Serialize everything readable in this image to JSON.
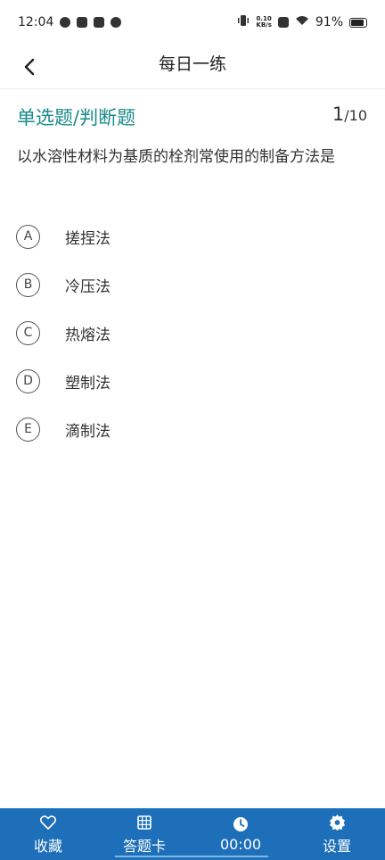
{
  "status_bar": {
    "time": "12:04",
    "net_speed_value": "0.10",
    "net_speed_unit": "KB/s",
    "battery": "91%"
  },
  "header": {
    "title": "每日一练",
    "back_icon": "chevron-left-icon"
  },
  "question": {
    "section_title": "单选题/判断题",
    "current": "1",
    "total": "/10",
    "text": "以水溶性材料为基质的栓剂常使用的制备方法是",
    "options": [
      {
        "letter": "A",
        "text": "搓捏法"
      },
      {
        "letter": "B",
        "text": "冷压法"
      },
      {
        "letter": "C",
        "text": "热熔法"
      },
      {
        "letter": "D",
        "text": "塑制法"
      },
      {
        "letter": "E",
        "text": "滴制法"
      }
    ]
  },
  "bottom_bar": {
    "tabs": [
      {
        "label": "收藏",
        "icon": "heart-icon"
      },
      {
        "label": "答题卡",
        "icon": "grid-icon"
      },
      {
        "label": "00:00",
        "icon": "clock-icon"
      },
      {
        "label": "设置",
        "icon": "gear-icon"
      }
    ]
  },
  "colors": {
    "accent_teal": "#1a8a8a",
    "bottom_bar": "#1c6fb8"
  }
}
